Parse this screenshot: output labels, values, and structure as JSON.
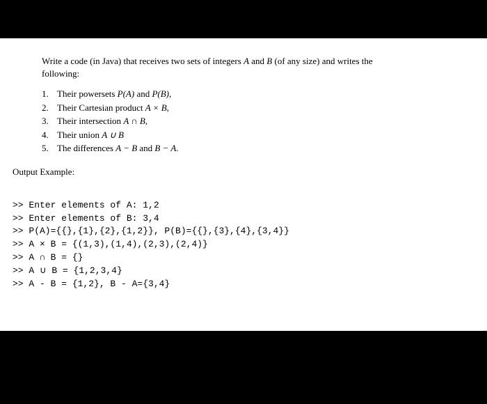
{
  "intro": {
    "line1_a": "Write a code (in Java) that receives two sets of integers ",
    "line1_A": "A",
    "line1_b": " and ",
    "line1_B": "B",
    "line1_c": " (of any size) and writes the",
    "line2": "following:"
  },
  "items": [
    {
      "num": "1.",
      "pre": "Their powersets ",
      "m1": "P(A)",
      "mid": " and ",
      "m2": "P(B)",
      "post": ","
    },
    {
      "num": "2.",
      "pre": "Their Cartesian product ",
      "m1": "A × B",
      "mid": "",
      "m2": "",
      "post": ","
    },
    {
      "num": "3.",
      "pre": "Their intersection ",
      "m1": "A ∩ B",
      "mid": "",
      "m2": "",
      "post": ","
    },
    {
      "num": "4.",
      "pre": "Their union ",
      "m1": "A ∪ B",
      "mid": "",
      "m2": "",
      "post": ""
    },
    {
      "num": "5.",
      "pre": "The differences ",
      "m1": "A − B",
      "mid": " and ",
      "m2": "B − A",
      "post": "."
    }
  ],
  "output_title": "Output Example:",
  "out": {
    "l1": ">> Enter elements of A: 1,2",
    "l2": ">> Enter elements of B: 3,4",
    "l3": ">> P(A)={{},{1},{2},{1,2}}, P(B)={{},{3},{4},{3,4}}",
    "l4": ">> A × B = {(1,3),(1,4),(2,3),(2,4)}",
    "l5": ">> A ∩ B = {}",
    "l6": ">> A ∪ B = {1,2,3,4}",
    "l7": ">> A - B = {1,2}, B - A={3,4}"
  }
}
